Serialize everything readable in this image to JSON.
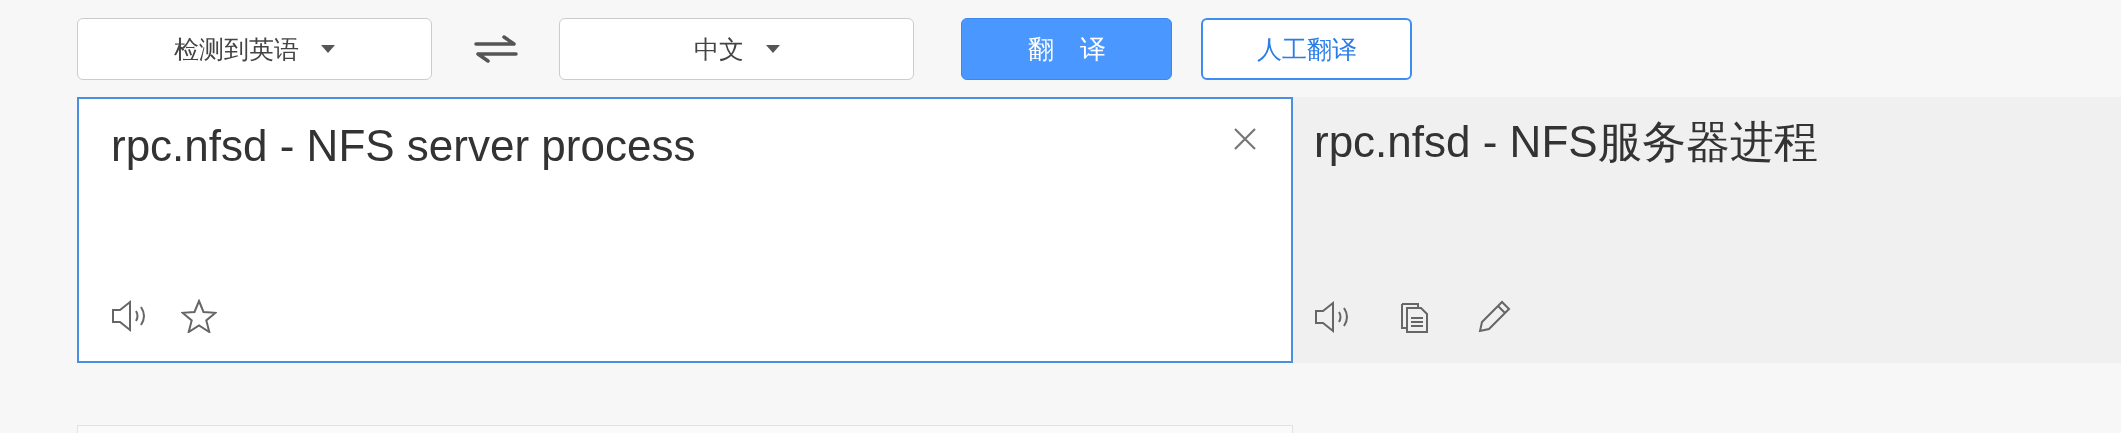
{
  "toolbar": {
    "source_language": "检测到英语",
    "target_language": "中文",
    "translate_button": "翻　译",
    "human_translation_button": "人工翻译"
  },
  "input": {
    "value": "rpc.nfsd - NFS server process"
  },
  "output": {
    "text": "rpc.nfsd - NFS服务器进程"
  }
}
